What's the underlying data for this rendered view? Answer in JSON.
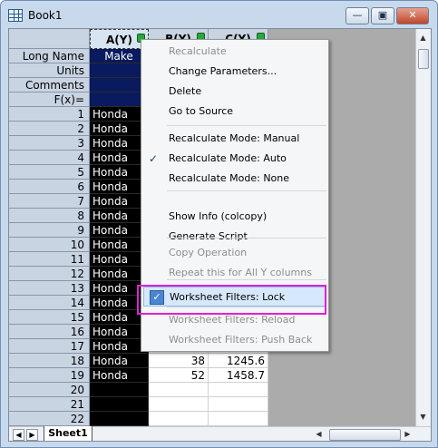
{
  "window": {
    "title": "Book1",
    "controls": [
      "—",
      "▣",
      "✕"
    ]
  },
  "columns": [
    {
      "label": "A(Y)",
      "locked": true
    },
    {
      "label": "B(Y)",
      "locked": true
    },
    {
      "label": "C(Y)",
      "locked": true
    }
  ],
  "meta_rows": [
    "Long Name",
    "Units",
    "Comments",
    "F(x)="
  ],
  "colA_long_name": "Make",
  "row_numbers": [
    "1",
    "2",
    "3",
    "4",
    "5",
    "6",
    "7",
    "8",
    "9",
    "10",
    "11",
    "12",
    "13",
    "14",
    "15",
    "16",
    "17",
    "18",
    "19",
    "20",
    "21",
    "22"
  ],
  "colA_values": [
    "Honda",
    "Honda",
    "Honda",
    "Honda",
    "Honda",
    "Honda",
    "Honda",
    "Honda",
    "Honda",
    "Honda",
    "Honda",
    "Honda",
    "Honda",
    "Honda",
    "Honda",
    "Honda",
    "Honda",
    "Honda",
    "Honda",
    "",
    "",
    ""
  ],
  "colB_values": [
    "",
    "",
    "",
    "",
    "",
    "",
    "",
    "",
    "",
    "",
    "",
    "",
    "",
    "",
    "",
    "",
    "",
    "38",
    "52",
    "",
    "",
    ""
  ],
  "colC_values": [
    "",
    "",
    "",
    "",
    "",
    "",
    "",
    "",
    "",
    "",
    "",
    "",
    "",
    "",
    "",
    "",
    "",
    "1245.6",
    "1458.7",
    "",
    "",
    ""
  ],
  "sheet_tab": "Sheet1",
  "context_menu": {
    "items": [
      {
        "label": "Recalculate",
        "disabled": true
      },
      {
        "label": "Change Parameters...",
        "disabled": false
      },
      {
        "label": "Delete",
        "disabled": false
      },
      {
        "label": "Go to Source",
        "disabled": false
      },
      {
        "label": "Recalculate Mode: Manual",
        "disabled": false
      },
      {
        "label": "Recalculate Mode: Auto",
        "disabled": false,
        "checked": true
      },
      {
        "label": "Recalculate Mode: None",
        "disabled": false
      },
      {
        "label": "Show Info (colcopy)",
        "disabled": false
      },
      {
        "label": "Generate Script",
        "disabled": false
      },
      {
        "label": "Copy Operation",
        "disabled": true
      },
      {
        "label": "Repeat this for All Y columns",
        "disabled": true
      },
      {
        "label": "Worksheet Filters: Lock",
        "disabled": false,
        "checked": true,
        "highlighted": true
      },
      {
        "label": "Worksheet Filters: Reload",
        "disabled": true
      },
      {
        "label": "Worksheet Filters: Push Back",
        "disabled": true
      }
    ]
  },
  "colors": {
    "highlight_frame": "#e020d8",
    "selected_column": "#000000",
    "lock_icon": "#27a83a"
  }
}
